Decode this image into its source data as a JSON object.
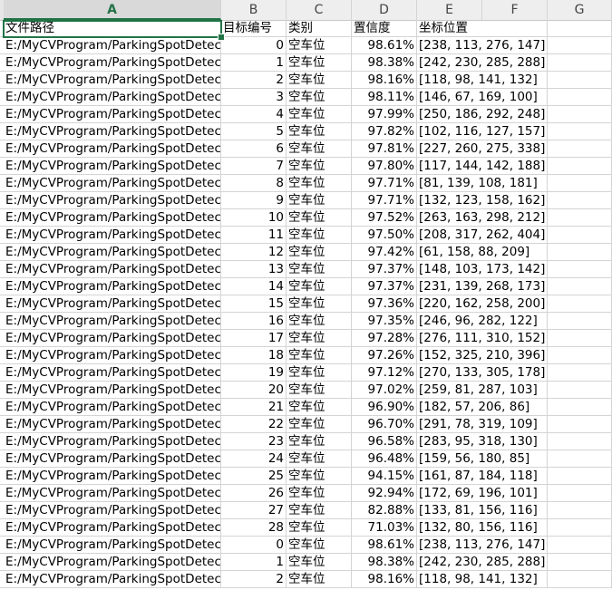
{
  "columns": [
    "A",
    "B",
    "C",
    "D",
    "E",
    "F",
    "G"
  ],
  "header_row": {
    "A": "文件路径",
    "B": "目标编号",
    "C": "类别",
    "D": "置信度",
    "E": "坐标位置"
  },
  "rows": [
    {
      "path": "E:/MyCVProgram/ParkingSpotDetec",
      "id": "0",
      "cls": "空车位",
      "conf": "98.61%",
      "box": "[238, 113, 276, 147]"
    },
    {
      "path": "E:/MyCVProgram/ParkingSpotDetec",
      "id": "1",
      "cls": "空车位",
      "conf": "98.38%",
      "box": "[242, 230, 285, 288]"
    },
    {
      "path": "E:/MyCVProgram/ParkingSpotDetec",
      "id": "2",
      "cls": "空车位",
      "conf": "98.16%",
      "box": "[118, 98, 141, 132]"
    },
    {
      "path": "E:/MyCVProgram/ParkingSpotDetec",
      "id": "3",
      "cls": "空车位",
      "conf": "98.11%",
      "box": "[146, 67, 169, 100]"
    },
    {
      "path": "E:/MyCVProgram/ParkingSpotDetec",
      "id": "4",
      "cls": "空车位",
      "conf": "97.99%",
      "box": "[250, 186, 292, 248]"
    },
    {
      "path": "E:/MyCVProgram/ParkingSpotDetec",
      "id": "5",
      "cls": "空车位",
      "conf": "97.82%",
      "box": "[102, 116, 127, 157]"
    },
    {
      "path": "E:/MyCVProgram/ParkingSpotDetec",
      "id": "6",
      "cls": "空车位",
      "conf": "97.81%",
      "box": "[227, 260, 275, 338]"
    },
    {
      "path": "E:/MyCVProgram/ParkingSpotDetec",
      "id": "7",
      "cls": "空车位",
      "conf": "97.80%",
      "box": "[117, 144, 142, 188]"
    },
    {
      "path": "E:/MyCVProgram/ParkingSpotDetec",
      "id": "8",
      "cls": "空车位",
      "conf": "97.71%",
      "box": "[81, 139, 108, 181]"
    },
    {
      "path": "E:/MyCVProgram/ParkingSpotDetec",
      "id": "9",
      "cls": "空车位",
      "conf": "97.71%",
      "box": "[132, 123, 158, 162]"
    },
    {
      "path": "E:/MyCVProgram/ParkingSpotDetec",
      "id": "10",
      "cls": "空车位",
      "conf": "97.52%",
      "box": "[263, 163, 298, 212]"
    },
    {
      "path": "E:/MyCVProgram/ParkingSpotDetec",
      "id": "11",
      "cls": "空车位",
      "conf": "97.50%",
      "box": "[208, 317, 262, 404]"
    },
    {
      "path": "E:/MyCVProgram/ParkingSpotDetec",
      "id": "12",
      "cls": "空车位",
      "conf": "97.42%",
      "box": "[61, 158, 88, 209]"
    },
    {
      "path": "E:/MyCVProgram/ParkingSpotDetec",
      "id": "13",
      "cls": "空车位",
      "conf": "97.37%",
      "box": "[148, 103, 173, 142]"
    },
    {
      "path": "E:/MyCVProgram/ParkingSpotDetec",
      "id": "14",
      "cls": "空车位",
      "conf": "97.37%",
      "box": "[231, 139, 268, 173]"
    },
    {
      "path": "E:/MyCVProgram/ParkingSpotDetec",
      "id": "15",
      "cls": "空车位",
      "conf": "97.36%",
      "box": "[220, 162, 258, 200]"
    },
    {
      "path": "E:/MyCVProgram/ParkingSpotDetec",
      "id": "16",
      "cls": "空车位",
      "conf": "97.35%",
      "box": "[246, 96, 282, 122]"
    },
    {
      "path": "E:/MyCVProgram/ParkingSpotDetec",
      "id": "17",
      "cls": "空车位",
      "conf": "97.28%",
      "box": "[276, 111, 310, 152]"
    },
    {
      "path": "E:/MyCVProgram/ParkingSpotDetec",
      "id": "18",
      "cls": "空车位",
      "conf": "97.26%",
      "box": "[152, 325, 210, 396]"
    },
    {
      "path": "E:/MyCVProgram/ParkingSpotDetec",
      "id": "19",
      "cls": "空车位",
      "conf": "97.12%",
      "box": "[270, 133, 305, 178]"
    },
    {
      "path": "E:/MyCVProgram/ParkingSpotDetec",
      "id": "20",
      "cls": "空车位",
      "conf": "97.02%",
      "box": "[259, 81, 287, 103]"
    },
    {
      "path": "E:/MyCVProgram/ParkingSpotDetec",
      "id": "21",
      "cls": "空车位",
      "conf": "96.90%",
      "box": "[182, 57, 206, 86]"
    },
    {
      "path": "E:/MyCVProgram/ParkingSpotDetec",
      "id": "22",
      "cls": "空车位",
      "conf": "96.70%",
      "box": "[291, 78, 319, 109]"
    },
    {
      "path": "E:/MyCVProgram/ParkingSpotDetec",
      "id": "23",
      "cls": "空车位",
      "conf": "96.58%",
      "box": "[283, 95, 318, 130]"
    },
    {
      "path": "E:/MyCVProgram/ParkingSpotDetec",
      "id": "24",
      "cls": "空车位",
      "conf": "96.48%",
      "box": "[159, 56, 180, 85]"
    },
    {
      "path": "E:/MyCVProgram/ParkingSpotDetec",
      "id": "25",
      "cls": "空车位",
      "conf": "94.15%",
      "box": "[161, 87, 184, 118]"
    },
    {
      "path": "E:/MyCVProgram/ParkingSpotDetec",
      "id": "26",
      "cls": "空车位",
      "conf": "92.94%",
      "box": "[172, 69, 196, 101]"
    },
    {
      "path": "E:/MyCVProgram/ParkingSpotDetec",
      "id": "27",
      "cls": "空车位",
      "conf": "82.88%",
      "box": "[133, 81, 156, 116]"
    },
    {
      "path": "E:/MyCVProgram/ParkingSpotDetec",
      "id": "28",
      "cls": "空车位",
      "conf": "71.03%",
      "box": "[132, 80, 156, 116]"
    },
    {
      "path": "E:/MyCVProgram/ParkingSpotDetec",
      "id": "0",
      "cls": "空车位",
      "conf": "98.61%",
      "box": "[238, 113, 276, 147]"
    },
    {
      "path": "E:/MyCVProgram/ParkingSpotDetec",
      "id": "1",
      "cls": "空车位",
      "conf": "98.38%",
      "box": "[242, 230, 285, 288]"
    },
    {
      "path": "E:/MyCVProgram/ParkingSpotDetec",
      "id": "2",
      "cls": "空车位",
      "conf": "98.16%",
      "box": "[118, 98, 141, 132]"
    }
  ],
  "colors": {
    "accent": "#217346",
    "gridline": "#d4d4d4",
    "header_bg": "#eeeeee"
  }
}
